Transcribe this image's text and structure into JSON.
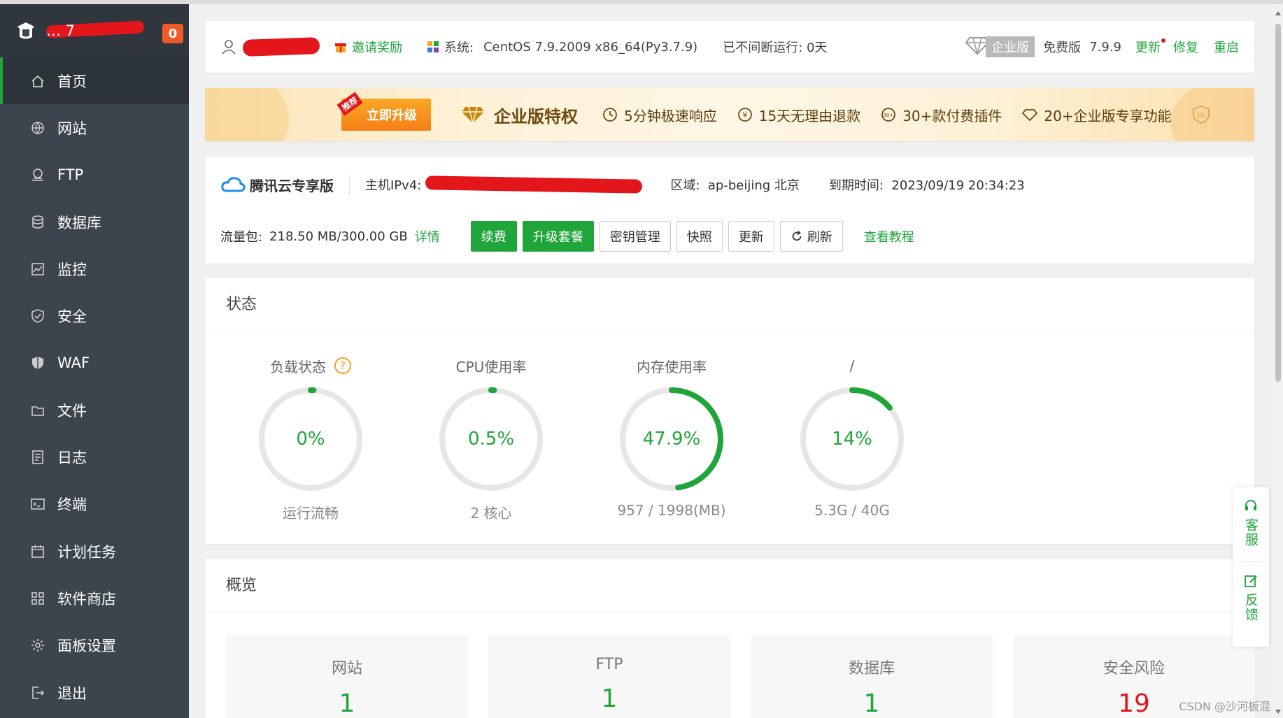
{
  "brand": {
    "name": "… 7",
    "badge": "0"
  },
  "nav": [
    {
      "label": "首页",
      "icon": "home-icon",
      "active": true
    },
    {
      "label": "网站",
      "icon": "globe-icon"
    },
    {
      "label": "FTP",
      "icon": "ftp-icon"
    },
    {
      "label": "数据库",
      "icon": "database-icon"
    },
    {
      "label": "监控",
      "icon": "monitor-icon"
    },
    {
      "label": "安全",
      "icon": "shield-icon"
    },
    {
      "label": "WAF",
      "icon": "waf-shield-icon"
    },
    {
      "label": "文件",
      "icon": "folder-icon"
    },
    {
      "label": "日志",
      "icon": "log-icon"
    },
    {
      "label": "终端",
      "icon": "terminal-icon"
    },
    {
      "label": "计划任务",
      "icon": "calendar-icon"
    },
    {
      "label": "软件商店",
      "icon": "apps-icon"
    },
    {
      "label": "面板设置",
      "icon": "gear-icon"
    },
    {
      "label": "退出",
      "icon": "logout-icon"
    }
  ],
  "topbar": {
    "invite": "邀请奖励",
    "sys_label": "系统:",
    "sys_value": "CentOS 7.9.2009 x86_64(Py3.7.9)",
    "uptime": "已不间断运行: 0天",
    "enterprise": "企业版",
    "free": "免费版",
    "version": "7.9.9",
    "update": "更新",
    "repair": "修复",
    "restart": "重启"
  },
  "banner": {
    "tag": "推荐",
    "upgrade": "立即升级",
    "title": "企业版特权",
    "features": [
      "5分钟极速响应",
      "15天无理由退款",
      "30+款付费插件",
      "20+企业版专享功能"
    ],
    "ssl": "SSL"
  },
  "cloud": {
    "brand": "腾讯云专享版",
    "ipv4_label": "主机IPv4:",
    "region_label": "区域:",
    "region_value": "ap-beijing 北京",
    "expire_label": "到期时间:",
    "expire_value": "2023/09/19 20:34:23",
    "traffic_label": "流量包:",
    "traffic_value": "218.50 MB/300.00 GB",
    "detail": "详情",
    "buttons": {
      "renew": "续费",
      "upgrade": "升级套餐",
      "keys": "密钥管理",
      "snapshot": "快照",
      "update": "更新",
      "refresh": "刷新"
    },
    "tutorial": "查看教程"
  },
  "status": {
    "title": "状态",
    "gauges": [
      {
        "label": "负载状态",
        "value": "0%",
        "percent": 0,
        "sub": "运行流畅",
        "help": "?"
      },
      {
        "label": "CPU使用率",
        "value": "0.5%",
        "percent": 0.5,
        "sub": "2 核心"
      },
      {
        "label": "内存使用率",
        "value": "47.9%",
        "percent": 47.9,
        "sub": "957 / 1998(MB)"
      },
      {
        "label": "/",
        "value": "14%",
        "percent": 14,
        "sub": "5.3G / 40G"
      }
    ],
    "accent": "#20a53a"
  },
  "overview": {
    "title": "概览",
    "cards": [
      {
        "title": "网站",
        "value": "1"
      },
      {
        "title": "FTP",
        "value": "1"
      },
      {
        "title": "数据库",
        "value": "1"
      },
      {
        "title": "安全风险",
        "value": "19",
        "danger": true
      }
    ]
  },
  "float": {
    "service": "客服",
    "feedback": "反馈"
  },
  "watermark": "CSDN @沙河板混"
}
